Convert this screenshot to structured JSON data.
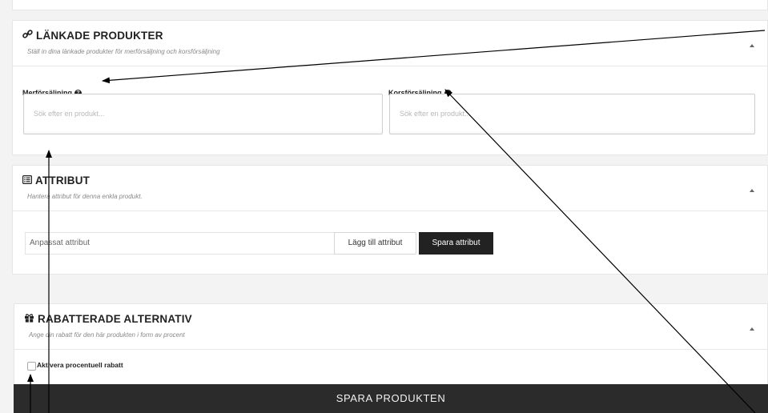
{
  "linked_products": {
    "title": "LÄNKADE PRODUKTER",
    "subtitle": "Ställ in dina länkade produkter för merförsäljning och korsförsäljning",
    "upsell_label": "Merförsäljning",
    "crosssell_label": "Korsförsäljning",
    "upsell_placeholder": "Sök efter en produkt...",
    "crosssell_placeholder": "Sök efter en produkt...",
    "title_icon": "link-icon",
    "help_icon": "question-circle-icon"
  },
  "attributes": {
    "title": "ATTRIBUT",
    "subtitle": "Hantera attribut för denna enkla produkt.",
    "custom_attribute_value": "Anpassat attribut",
    "add_button": "Lägg till attribut",
    "save_button": "Spara attribut",
    "title_icon": "list-icon"
  },
  "discount": {
    "title": "RABATTERADE ALTERNATIV",
    "subtitle": "Ange din rabatt för den här produkten i form av procent",
    "checkbox_label": "Aktivera procentuell rabatt",
    "checkbox_checked": false,
    "title_icon": "gift-icon"
  },
  "footer": {
    "save_product": "SPARA PRODUKTEN"
  },
  "colors": {
    "dark_bar": "#2b2b2b",
    "page_bg": "#f3f3f3"
  }
}
